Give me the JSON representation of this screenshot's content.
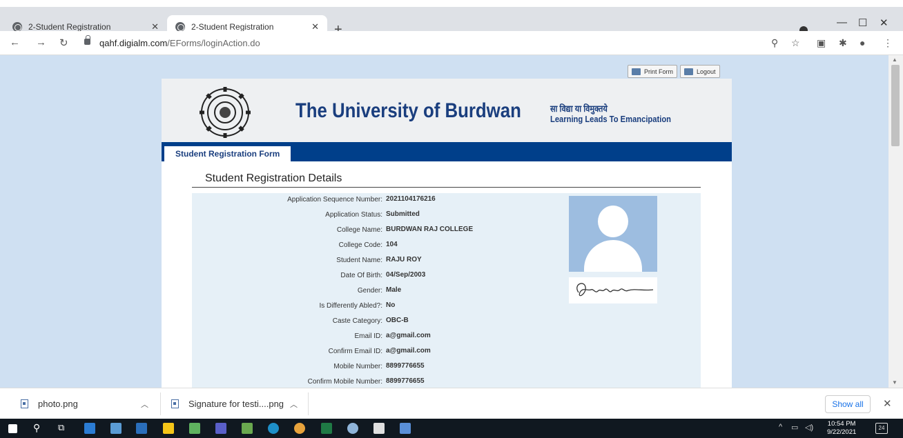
{
  "browser": {
    "tabs": [
      {
        "title": "2-Student Registration",
        "active": false
      },
      {
        "title": "2-Student Registration",
        "active": true
      }
    ],
    "url_host": "qahf.digialm.com",
    "url_path": "/EForms/loginAction.do"
  },
  "toolbar": {
    "print_label": "Print Form",
    "logout_label": "Logout"
  },
  "header": {
    "university_name": "The University of Burdwan",
    "motto_hindi": "सा विद्या या विमुक्तये",
    "motto_english": "Learning Leads To Emancipation"
  },
  "nav": {
    "active_tab": "Student Registration Form"
  },
  "section_title": "Student Registration Details",
  "details": [
    {
      "label": "Application Sequence Number:",
      "value": "2021104176216"
    },
    {
      "label": "Application Status:",
      "value": "Submitted"
    },
    {
      "label": "College Name:",
      "value": "BURDWAN RAJ COLLEGE"
    },
    {
      "label": "College Code:",
      "value": "104"
    },
    {
      "label": "Student Name:",
      "value": "RAJU ROY"
    },
    {
      "label": "Date Of Birth:",
      "value": "04/Sep/2003"
    },
    {
      "label": "Gender:",
      "value": "Male"
    },
    {
      "label": "Is Differently Abled?:",
      "value": "No"
    },
    {
      "label": "Caste Category:",
      "value": "OBC-B"
    },
    {
      "label": "Email ID:",
      "value": "a@gmail.com"
    },
    {
      "label": "Confirm Email ID:",
      "value": "a@gmail.com"
    },
    {
      "label": "Mobile Number:",
      "value": "8899776655"
    },
    {
      "label": "Confirm Mobile Number:",
      "value": "8899776655"
    }
  ],
  "downloads": {
    "items": [
      "photo.png",
      "Signature for testi....png"
    ],
    "show_all": "Show all"
  },
  "taskbar": {
    "time": "10:54 PM",
    "date": "9/22/2021",
    "notifications": "24"
  },
  "colors": {
    "page_bg": "#cfe0f2",
    "nav_band": "#003f8a",
    "brand_text": "#1a3e7e",
    "details_bg": "#e6f0f7"
  }
}
